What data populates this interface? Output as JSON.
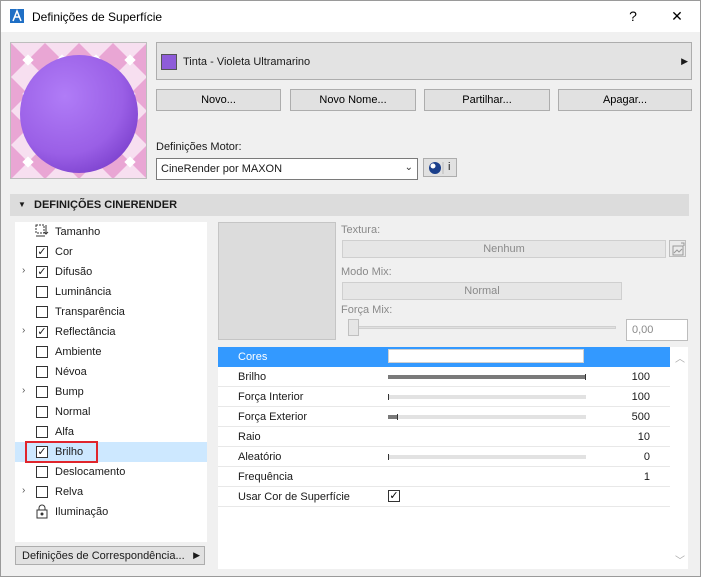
{
  "window": {
    "title": "Definições de Superfície",
    "help_btn": "?",
    "close_btn": "✕"
  },
  "colors": {
    "material_swatch": "#8e5cd9",
    "selection": "#3399ff",
    "highlight_box": "#e0252c",
    "sphere": "#9a5fe6"
  },
  "material": {
    "name": "Tinta - Violeta Ultramarino",
    "arrow": "▶"
  },
  "actions": {
    "new": "Novo...",
    "new_name": "Novo Nome...",
    "share": "Partilhar...",
    "delete": "Apagar..."
  },
  "engine": {
    "label": "Definições Motor:",
    "selected": "CineRender por MAXON",
    "info_letter": "i"
  },
  "section": {
    "title": "DEFINIÇÕES CINERENDER"
  },
  "channels": [
    {
      "label": "Tamanho",
      "checked": false,
      "expandable": false,
      "icon": "size-icon"
    },
    {
      "label": "Cor",
      "checked": true,
      "expandable": false
    },
    {
      "label": "Difusão",
      "checked": true,
      "expandable": true
    },
    {
      "label": "Luminância",
      "checked": false,
      "expandable": false
    },
    {
      "label": "Transparência",
      "checked": false,
      "expandable": false
    },
    {
      "label": "Reflectância",
      "checked": true,
      "expandable": true
    },
    {
      "label": "Ambiente",
      "checked": false,
      "expandable": false
    },
    {
      "label": "Névoa",
      "checked": false,
      "expandable": false
    },
    {
      "label": "Bump",
      "checked": false,
      "expandable": true
    },
    {
      "label": "Normal",
      "checked": false,
      "expandable": false
    },
    {
      "label": "Alfa",
      "checked": false,
      "expandable": false
    },
    {
      "label": "Brilho",
      "checked": true,
      "expandable": false,
      "selected": true
    },
    {
      "label": "Deslocamento",
      "checked": false,
      "expandable": false
    },
    {
      "label": "Relva",
      "checked": false,
      "expandable": true
    },
    {
      "label": "Iluminação",
      "checked": false,
      "expandable": false,
      "icon": "lock-icon"
    }
  ],
  "mapping_button": "Definições de Correspondência...",
  "texture": {
    "label": "Textura:",
    "value": "Nenhum",
    "mix_label": "Modo Mix:",
    "mix_value": "Normal",
    "force_label": "Força Mix:",
    "force_value": "0,00"
  },
  "params": [
    {
      "label": "Cores",
      "type": "color",
      "selected": true
    },
    {
      "label": "Brilho",
      "type": "slider",
      "value": "100",
      "fraction": 1.0
    },
    {
      "label": "Força Interior",
      "type": "slider",
      "value": "100",
      "fraction": 0.0
    },
    {
      "label": "Força Exterior",
      "type": "slider",
      "value": "500",
      "fraction": 0.05
    },
    {
      "label": "Raio",
      "type": "number",
      "value": "10"
    },
    {
      "label": "Aleatório",
      "type": "slider",
      "value": "0",
      "fraction": 0.0
    },
    {
      "label": "Frequência",
      "type": "number",
      "value": "1"
    },
    {
      "label": "Usar Cor de Superfície",
      "type": "checkbox",
      "checked": true
    }
  ]
}
